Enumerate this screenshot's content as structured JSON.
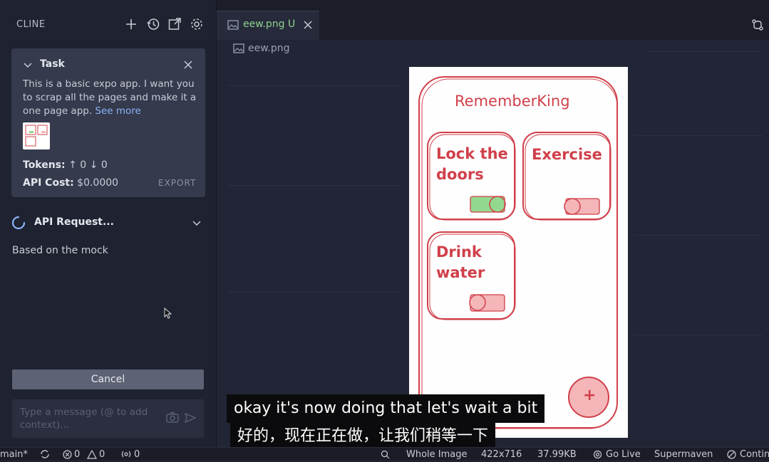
{
  "sidebar": {
    "title": "CLINE",
    "toolbar": [
      "plus-icon",
      "history-icon",
      "popout-icon",
      "gear-icon"
    ],
    "task": {
      "heading": "Task",
      "description": "This is a basic expo app. I want you to scrap all the pages and make it a one page app.",
      "see_more": "See more",
      "tokens_label": "Tokens:",
      "tokens_up": "↑ 0",
      "tokens_down": "↓ 0",
      "cost_label": "API Cost:",
      "cost_value": "$0.0000",
      "export_label": "EXPORT"
    },
    "api_request_label": "API Request...",
    "message_text": "Based on the mock",
    "cancel_label": "Cancel",
    "input_placeholder": "Type a message (@ to add context)..."
  },
  "editor": {
    "tab_label": "eew.png U",
    "breadcrumb": "eew.png",
    "mock": {
      "app_title": "RememberKing",
      "cards": [
        {
          "title_line1": "Lock the",
          "title_line2": "doors",
          "toggle_on": true
        },
        {
          "title_line1": "Exercise",
          "title_line2": "",
          "toggle_on": false
        },
        {
          "title_line1": "Drink",
          "title_line2": "water",
          "toggle_on": false
        }
      ],
      "fab_label": "+"
    }
  },
  "subtitles": {
    "english": "okay it's now doing that let's wait a bit",
    "chinese": "好的，现在正在做，让我们稍等一下"
  },
  "statusbar": {
    "branch": "main*",
    "errors": "0",
    "warnings": "0",
    "ports": "0",
    "zoom_label": "Whole Image",
    "dimensions": "422x716",
    "filesize": "37.99KB",
    "golive": "Go Live",
    "supermaven": "Supermaven",
    "continue": "Contin"
  },
  "colors": {
    "sketch_red": "#d0404a",
    "toggle_on": "#93d88f",
    "toggle_off": "#f4b6b8",
    "link_blue": "#8ab4f8"
  }
}
